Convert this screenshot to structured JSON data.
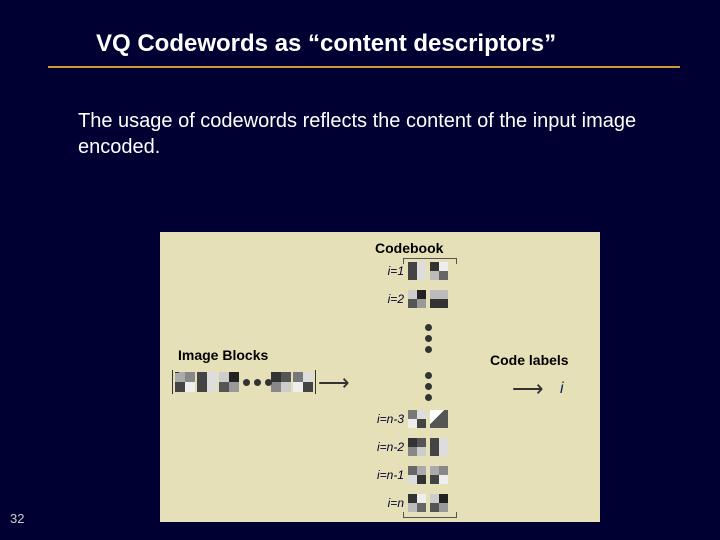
{
  "slide": {
    "title": "VQ Codewords as “content descriptors”",
    "body": "The usage of codewords reflects the content of the input image encoded.",
    "number": "32"
  },
  "diagram": {
    "codebook_title": "Codebook",
    "image_blocks_title": "Image Blocks",
    "code_labels_title": "Code labels",
    "output_label": "i",
    "rows": [
      {
        "label": "i=1"
      },
      {
        "label": "i=2"
      },
      {
        "label": "i=n-3"
      },
      {
        "label": "i=n-2"
      },
      {
        "label": "i=n-1"
      },
      {
        "label": "i=n"
      }
    ]
  }
}
